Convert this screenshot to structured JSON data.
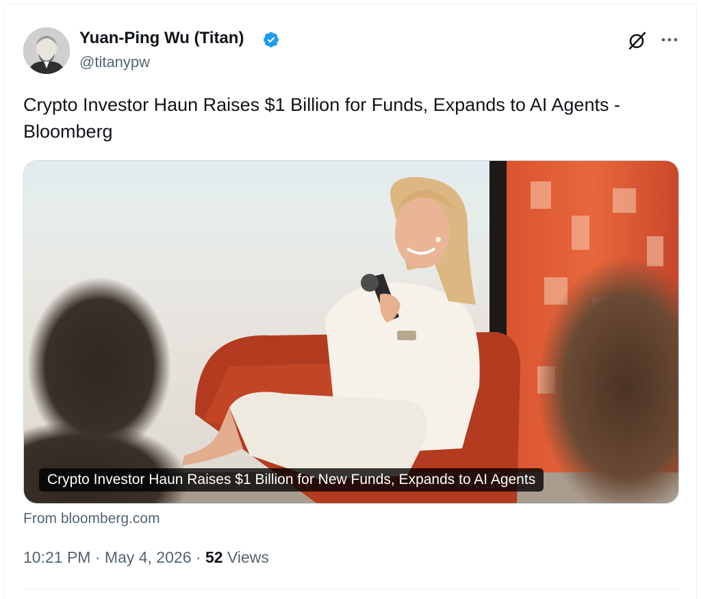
{
  "author": {
    "display_name": "Yuan-Ping Wu (Titan)",
    "handle": "@titanypw",
    "verified": true
  },
  "tweet": {
    "text": "Crypto Investor Haun Raises $1 Billion for Funds, Expands to AI Agents - Bloomberg"
  },
  "link_card": {
    "caption": "Crypto Investor Haun Raises $1 Billion for New Funds, Expands to AI Agents",
    "source": "From bloomberg.com"
  },
  "meta": {
    "time": "10:21 PM",
    "separator": "·",
    "date": "May 4, 2026",
    "views_count": "52",
    "views_label": "Views"
  },
  "icons": {
    "verified": "verified-badge-icon",
    "grok": "grok-icon",
    "more": "more-options-icon"
  },
  "colors": {
    "verified_blue": "#1d9bf0",
    "secondary_text": "#536471",
    "primary_text": "#0f1419"
  }
}
